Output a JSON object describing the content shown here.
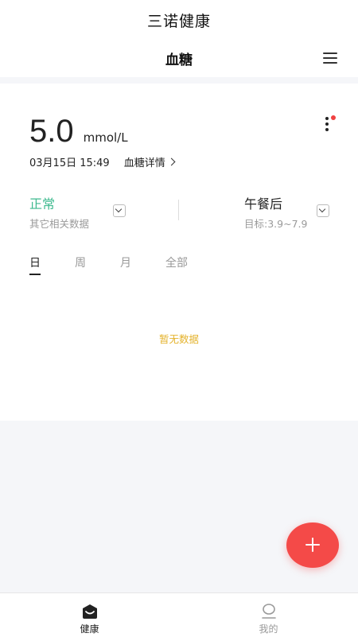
{
  "app": {
    "title": "三诺健康"
  },
  "header": {
    "title": "血糖",
    "menu_icon": "menu-icon"
  },
  "reading": {
    "value": "5.0",
    "unit": "mmol/L",
    "datetime": "03月15日 15:49",
    "detail_link": "血糖详情"
  },
  "filters": {
    "status": "正常",
    "status_sub": "其它相关数据",
    "meal": "午餐后",
    "target": "目标:3.9~7.9"
  },
  "tabs": [
    {
      "label": "日",
      "active": true
    },
    {
      "label": "周",
      "active": false
    },
    {
      "label": "月",
      "active": false
    },
    {
      "label": "全部",
      "active": false
    }
  ],
  "empty_text": "暂无数据",
  "colors": {
    "accent": "#f44a48",
    "status_green": "#3fba8f",
    "empty_text": "#e4b22b"
  },
  "bottom_nav": [
    {
      "label": "健康",
      "icon": "health-icon",
      "active": true
    },
    {
      "label": "我的",
      "icon": "profile-icon",
      "active": false
    }
  ]
}
